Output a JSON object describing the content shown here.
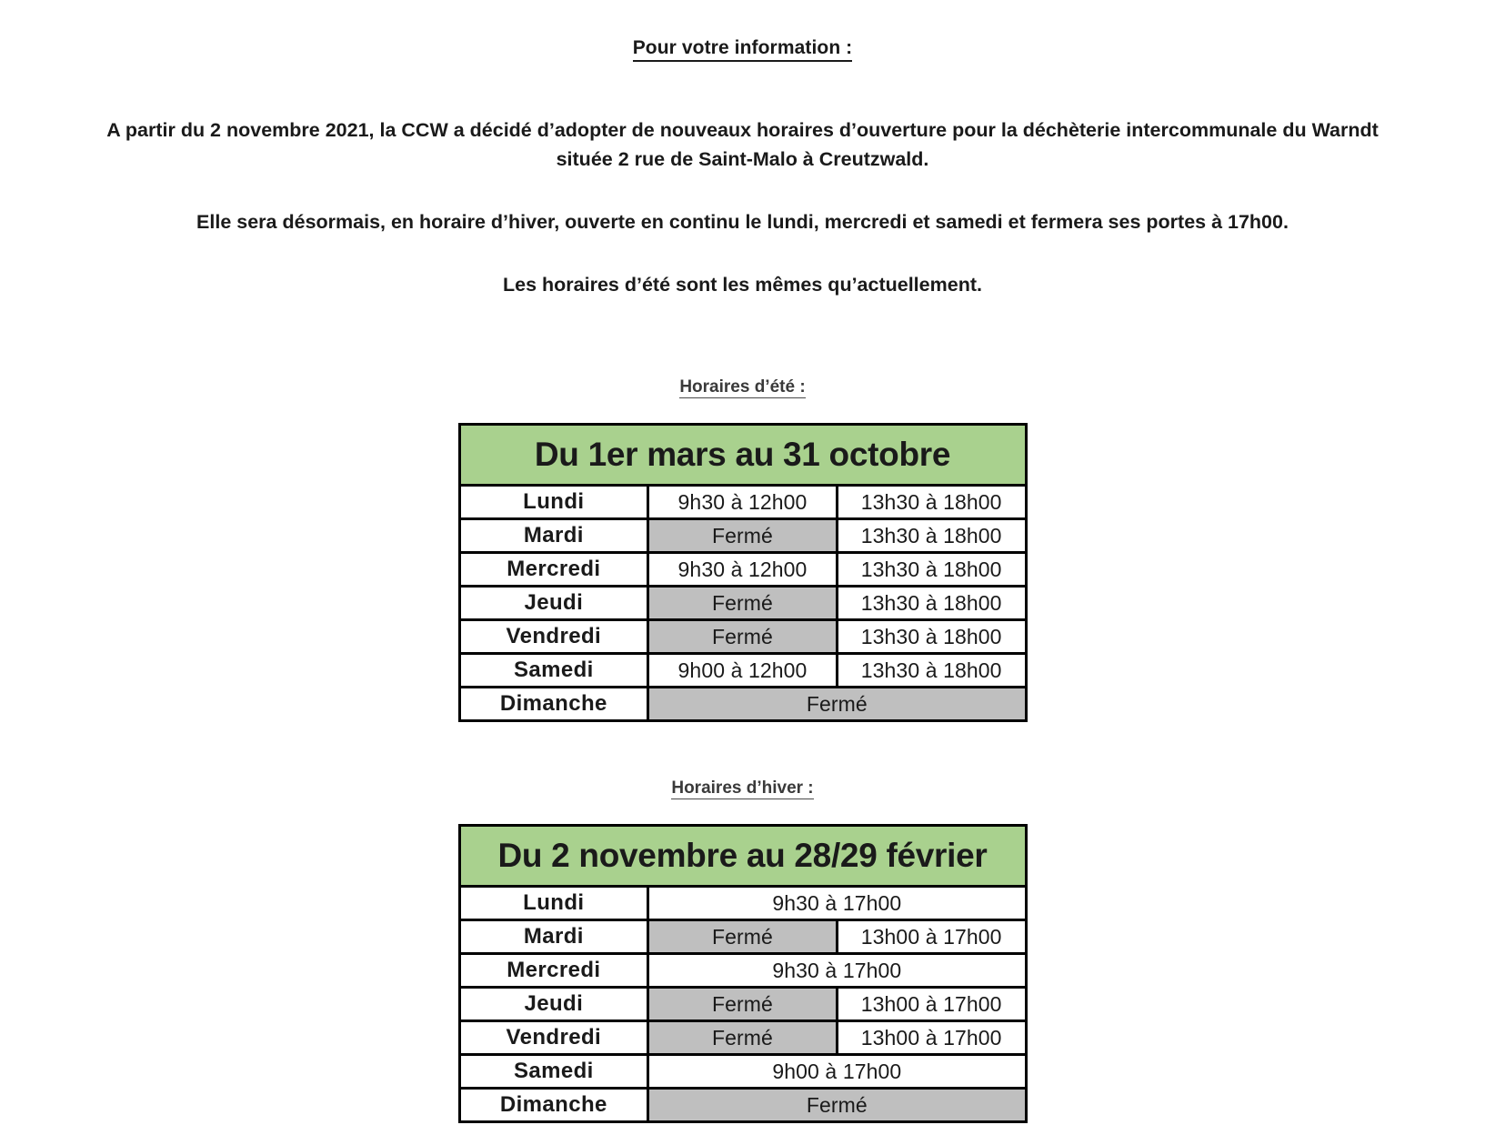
{
  "document": {
    "title": "Pour votre information :",
    "paragraphs": [
      "A partir du 2 novembre 2021, la CCW a décidé d’adopter de nouveaux horaires d’ouverture pour la déchèterie intercommunale du Warndt située 2 rue de Saint-Malo à Creutzwald.",
      "Elle sera désormais, en horaire d’hiver, ouverte en continu le lundi, mercredi et samedi et fermera ses portes à 17h00.",
      "Les horaires d’été sont les mêmes qu’actuellement."
    ]
  },
  "summer": {
    "label": "Horaires d’été :",
    "header": "Du 1er mars au 31 octobre",
    "rows": [
      {
        "day": "Lundi",
        "morning": "9h30 à 12h00",
        "morning_closed": false,
        "afternoon": "13h30 à 18h00",
        "span": false
      },
      {
        "day": "Mardi",
        "morning": "Fermé",
        "morning_closed": true,
        "afternoon": "13h30 à 18h00",
        "span": false
      },
      {
        "day": "Mercredi",
        "morning": "9h30 à 12h00",
        "morning_closed": false,
        "afternoon": "13h30 à 18h00",
        "span": false
      },
      {
        "day": "Jeudi",
        "morning": "Fermé",
        "morning_closed": true,
        "afternoon": "13h30 à 18h00",
        "span": false
      },
      {
        "day": "Vendredi",
        "morning": "Fermé",
        "morning_closed": true,
        "afternoon": "13h30 à 18h00",
        "span": false
      },
      {
        "day": "Samedi",
        "morning": "9h00 à 12h00",
        "morning_closed": false,
        "afternoon": "13h30 à 18h00",
        "span": false
      },
      {
        "day": "Dimanche",
        "morning": "Fermé",
        "morning_closed": true,
        "afternoon": "",
        "span": true
      }
    ]
  },
  "winter": {
    "label": "Horaires d’hiver :",
    "header": "Du 2 novembre au 28/29 février",
    "rows": [
      {
        "day": "Lundi",
        "morning": "9h30 à 17h00",
        "morning_closed": false,
        "afternoon": "",
        "span": true
      },
      {
        "day": "Mardi",
        "morning": "Fermé",
        "morning_closed": true,
        "afternoon": "13h00 à 17h00",
        "span": false
      },
      {
        "day": "Mercredi",
        "morning": "9h30 à 17h00",
        "morning_closed": false,
        "afternoon": "",
        "span": true
      },
      {
        "day": "Jeudi",
        "morning": "Fermé",
        "morning_closed": true,
        "afternoon": "13h00 à 17h00",
        "span": false
      },
      {
        "day": "Vendredi",
        "morning": "Fermé",
        "morning_closed": true,
        "afternoon": "13h00 à 17h00",
        "span": false
      },
      {
        "day": "Samedi",
        "morning": "9h00 à 17h00",
        "morning_closed": false,
        "afternoon": "",
        "span": true
      },
      {
        "day": "Dimanche",
        "morning": "Fermé",
        "morning_closed": true,
        "afternoon": "",
        "span": true
      }
    ]
  },
  "colors": {
    "header_green": "#a9d18e",
    "closed_grey": "#bfbfbf",
    "border_black": "#000000",
    "text": "#1a1a1a"
  }
}
